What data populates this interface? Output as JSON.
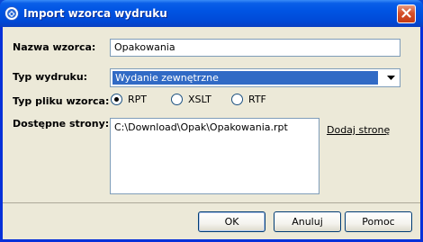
{
  "window": {
    "title": "Import wzorca wydruku",
    "icon": "gear-app-icon",
    "close_icon": "close-icon"
  },
  "form": {
    "template_name": {
      "label": "Nazwa wzorca:",
      "value": "Opakowania"
    },
    "print_type": {
      "label": "Typ wydruku:",
      "value": "Wydanie zewnętrzne"
    },
    "file_type": {
      "label": "Typ pliku wzorca:",
      "options": [
        {
          "label": "RPT",
          "checked": true
        },
        {
          "label": "XSLT",
          "checked": false
        },
        {
          "label": "RTF",
          "checked": false
        }
      ]
    },
    "pages": {
      "label": "Dostępne strony:",
      "value": "C:\\Download\\Opak\\Opakowania.rpt",
      "add_link": "Dodaj stronę"
    }
  },
  "buttons": {
    "ok": "OK",
    "cancel": "Anuluj",
    "help": "Pomoc"
  },
  "colors": {
    "titlebar": "#0054e3",
    "dialog_bg": "#ece9d8",
    "selection": "#316ac5"
  }
}
